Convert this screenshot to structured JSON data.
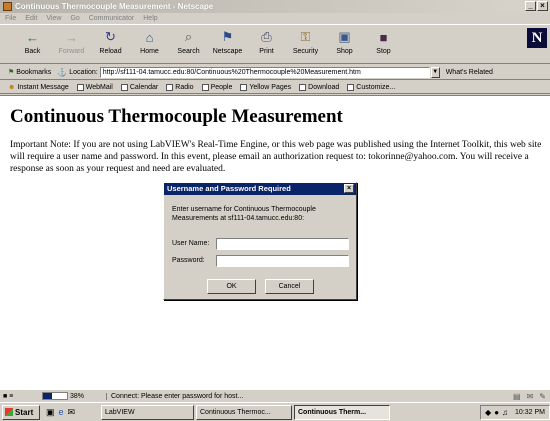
{
  "window": {
    "title": "Continuous Thermocouple Measurement - Netscape",
    "controls": [
      "_",
      "×"
    ]
  },
  "menu": [
    "File",
    "Edit",
    "View",
    "Go",
    "Communicator",
    "Help"
  ],
  "toolbar": {
    "buttons": [
      {
        "label": "Back",
        "icon": "back-arrow-icon",
        "glyph": "←",
        "enabled": true
      },
      {
        "label": "Forward",
        "icon": "forward-arrow-icon",
        "glyph": "→",
        "enabled": false
      },
      {
        "label": "Reload",
        "icon": "reload-icon",
        "glyph": "↻",
        "enabled": true
      },
      {
        "label": "Home",
        "icon": "home-icon",
        "glyph": "⌂",
        "enabled": true
      },
      {
        "label": "Search",
        "icon": "search-icon",
        "glyph": "⌕",
        "enabled": true
      },
      {
        "label": "Netscape",
        "icon": "netscape-icon",
        "glyph": "⚑",
        "enabled": true
      },
      {
        "label": "Print",
        "icon": "print-icon",
        "glyph": "⎙",
        "enabled": true
      },
      {
        "label": "Security",
        "icon": "security-lock-icon",
        "glyph": "⚿",
        "enabled": true
      },
      {
        "label": "Shop",
        "icon": "shop-bag-icon",
        "glyph": "▣",
        "enabled": true
      },
      {
        "label": "Stop",
        "icon": "stop-icon",
        "glyph": "■",
        "enabled": true
      }
    ],
    "logo": "N"
  },
  "location": {
    "bookmarks_label": "Bookmarks",
    "label": "Location:",
    "url": "http://sf111-04.tamucc.edu:80/Continuous%20Thermocouple%20Measurement.htm",
    "related_label": "What's Related"
  },
  "personal_toolbar": [
    "Instant Message",
    "WebMail",
    "Calendar",
    "Radio",
    "People",
    "Yellow Pages",
    "Download",
    "Customize..."
  ],
  "page": {
    "heading": "Continuous Thermocouple Measurement",
    "note": "Important Note: If you are not using LabVIEW's Real-Time Engine, or this web page was published using the Internet Toolkit, this web site will require a user name and password. In this event, please email an authorization request to: tokorinne@yahoo.com. You will receive a response as soon as your request and need are evaluated."
  },
  "dialog": {
    "title": "Username and Password Required",
    "close": "×",
    "message": "Enter username for Continuous Thermocouple Measurements at sf111-04.tamucc.edu:80:",
    "username_label": "User Name:",
    "username_value": "",
    "password_label": "Password:",
    "password_value": "",
    "ok_label": "OK",
    "cancel_label": "Cancel"
  },
  "status": {
    "progress_percent": 38,
    "percent_text": "38%",
    "message": "Connect: Please enter password for host..."
  },
  "taskbar": {
    "start_label": "Start",
    "tasks": [
      {
        "label": "LabVIEW",
        "active": false
      },
      {
        "label": "Continuous Thermoc...",
        "active": false
      },
      {
        "label": "Continuous Therm...",
        "active": true
      }
    ],
    "clock": "10:32 PM"
  }
}
